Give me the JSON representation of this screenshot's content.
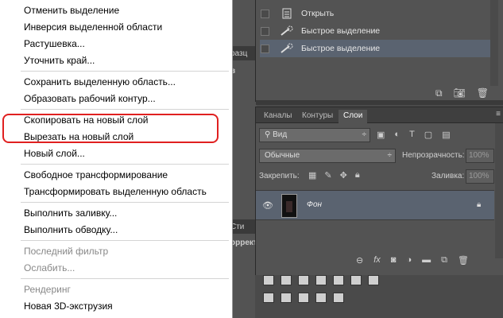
{
  "context_menu": {
    "items": [
      {
        "label": "Отменить выделение",
        "enabled": true
      },
      {
        "label": "Инверсия выделенной области",
        "enabled": true
      },
      {
        "label": "Растушевка...",
        "enabled": true
      },
      {
        "label": "Уточнить край...",
        "enabled": true
      },
      {
        "label": "Сохранить выделенную область...",
        "enabled": true
      },
      {
        "label": "Образовать рабочий контур...",
        "enabled": true
      },
      {
        "label": "Скопировать на новый слой",
        "enabled": true
      },
      {
        "label": "Вырезать на новый слой",
        "enabled": true
      },
      {
        "label": "Новый слой...",
        "enabled": true
      },
      {
        "label": "Свободное трансформирование",
        "enabled": true
      },
      {
        "label": "Трансформировать выделенную область",
        "enabled": true
      },
      {
        "label": "Выполнить заливку...",
        "enabled": true
      },
      {
        "label": "Выполнить обводку...",
        "enabled": true
      },
      {
        "label": "Последний фильтр",
        "enabled": false
      },
      {
        "label": "Ослабить...",
        "enabled": false
      },
      {
        "label": "Рендеринг",
        "enabled": false
      },
      {
        "label": "Новая 3D-экструзия",
        "enabled": true
      }
    ],
    "highlight_color": "#e02020"
  },
  "history": {
    "items": [
      {
        "label": "Открыть",
        "icon": "document-icon"
      },
      {
        "label": "Быстрое выделение",
        "icon": "quick-selection-icon"
      },
      {
        "label": "Быстрое выделение",
        "icon": "quick-selection-icon",
        "selected": true
      }
    ]
  },
  "layers_panel": {
    "tabs": [
      "Каналы",
      "Контуры",
      "Слои"
    ],
    "active_tab": "Слои",
    "kind_filter": "Вид",
    "blend_mode": "Обычные",
    "opacity_label": "Непрозрачность:",
    "opacity_value": "100%",
    "lock_label": "Закрепить:",
    "fill_label": "Заливка:",
    "fill_value": "100%",
    "layer": {
      "name": "Фон",
      "locked": true,
      "visible": true
    }
  },
  "background_fragments": {
    "tab_fragment": "разц",
    "label_fragment": "в",
    "tab_fragment_2": "Сти",
    "label_fragment_2": "оррект"
  },
  "colors": {
    "panel_bg": "#535353",
    "selection_bg": "#5a6370",
    "menu_bg": "#ffffff"
  }
}
